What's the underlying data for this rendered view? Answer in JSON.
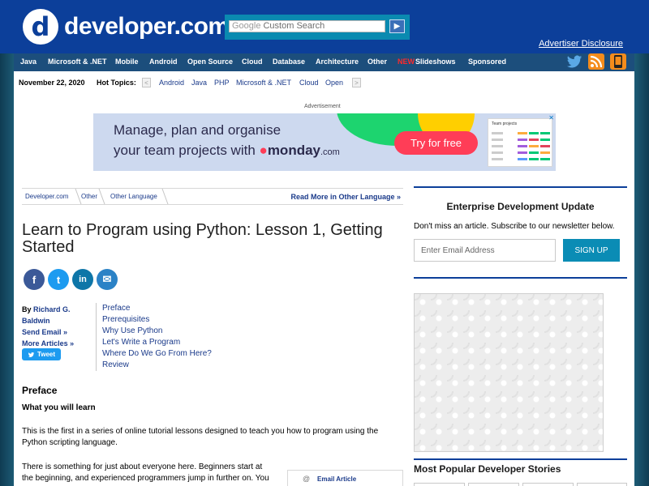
{
  "header": {
    "logo_mark": "d",
    "logo_text": "developer.com",
    "search_brand": "Google",
    "search_placeholder": "Custom Search",
    "search_button": "▶",
    "advertiser_disclosure": "Advertiser Disclosure"
  },
  "nav": {
    "items": [
      "Java",
      "Microsoft & .NET",
      "Mobile",
      "Android",
      "Open Source",
      "Cloud",
      "Database",
      "Architecture",
      "Other"
    ],
    "new_label": "NEW",
    "slideshows": "Slideshows",
    "sponsored": "Sponsored"
  },
  "hot_topics": {
    "date": "November 22, 2020",
    "label": "Hot Topics:",
    "prev": "<",
    "next": ">",
    "links": [
      "Android",
      "Java",
      "PHP",
      "Microsoft & .NET",
      "Cloud",
      "Open"
    ]
  },
  "advert": {
    "label": "Advertisement",
    "line1": "Manage, plan and organise",
    "line2_prefix": "your team projects with",
    "brand": "monday",
    "brand_suffix": ".com",
    "cta": "Try for free",
    "board_title": "Team projects",
    "close_icon": "✕"
  },
  "breadcrumb": {
    "items": [
      "Developer.com",
      "Other",
      "Other Language"
    ],
    "read_more": "Read More in Other Language »"
  },
  "article": {
    "title": "Learn to Program using Python: Lesson 1, Getting Started",
    "share": {
      "facebook": "f",
      "twitter": "t",
      "linkedin": "in",
      "email": "✉"
    },
    "author_by": "By",
    "author_name": "Richard G. Baldwin",
    "send_email": "Send Email »",
    "more_articles": "More Articles »",
    "tweet": "Tweet",
    "toc": [
      "Preface",
      "Prerequisites",
      "Why Use Python",
      "Let's Write a Program",
      "Where Do We Go From Here?",
      "Review"
    ],
    "section_title": "Preface",
    "subheading": "What you will learn",
    "para1_line1": "This is the first in a series of online tutorial lessons designed to teach you how to program using the",
    "para1_line2": "Python scripting language.",
    "para2_line1": "There is something for just about everyone here.  Beginners start at",
    "para2_line2": "the beginning, and experienced programmers jump in further on.  You",
    "email_article": "Email Article",
    "email_at": "@"
  },
  "sidebar": {
    "newsletter_title": "Enterprise Development Update",
    "newsletter_text": "Don't miss an article. Subscribe to our newsletter below.",
    "email_placeholder": "Enter Email Address",
    "signup": "SIGN UP",
    "most_popular": "Most Popular Developer Stories"
  },
  "colors": {
    "header_blue": "#0c3f9a",
    "nav_blue": "#1c4e7c",
    "link_blue": "#1a3a8a",
    "teal": "#0a8cb5",
    "new_red": "#ff2a2a"
  }
}
